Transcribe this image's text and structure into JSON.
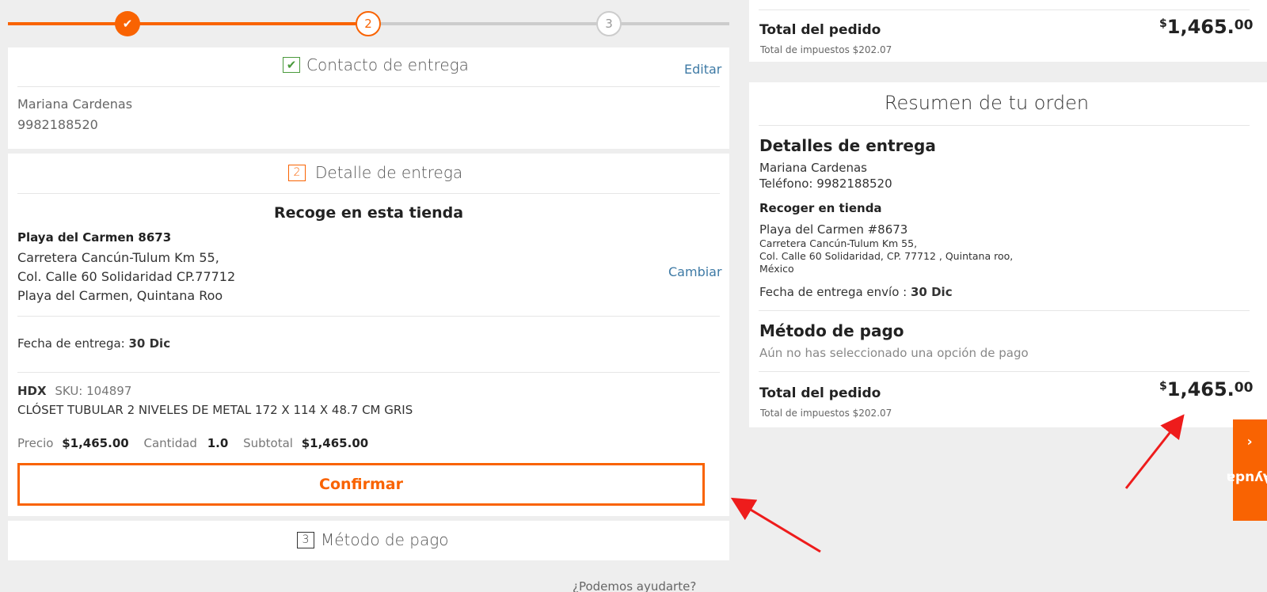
{
  "stepper": {
    "steps": [
      {
        "label": "✔",
        "state": "done"
      },
      {
        "label": "2",
        "state": "active"
      },
      {
        "label": "3",
        "state": "pending"
      }
    ]
  },
  "contact": {
    "title": "Contacto de entrega",
    "edit_label": "Editar",
    "name": "Mariana Cardenas",
    "phone": "9982188520"
  },
  "delivery": {
    "step_number": "2",
    "title": "Detalle de entrega",
    "pickup_heading": "Recoge en esta tienda",
    "store_name": "Playa del Carmen 8673",
    "address_line1": "Carretera Cancún-Tulum Km 55,",
    "address_line2": "Col. Calle 60 Solidaridad CP.77712",
    "address_line3": "Playa del Carmen, Quintana Roo",
    "change_label": "Cambiar",
    "date_label": "Fecha de entrega:",
    "date_value": "30 Dic",
    "product": {
      "brand": "HDX",
      "sku": "SKU: 104897",
      "name": "CLÓSET TUBULAR 2 NIVELES DE METAL 172 X 114 X 48.7 CM GRIS",
      "price_label": "Precio",
      "price_value": "$1,465.00",
      "qty_label": "Cantidad",
      "qty_value": "1.0",
      "subtotal_label": "Subtotal",
      "subtotal_value": "$1,465.00"
    },
    "confirm_label": "Confirmar"
  },
  "payment_step": {
    "step_number": "3",
    "title": "Método de pago"
  },
  "footer": {
    "help_text": "¿Podemos ayudarte?"
  },
  "top_total": {
    "label": "Total del pedido",
    "tax": "Total de impuestos $202.07",
    "currency": "$",
    "amount": "1,465.",
    "cents": "00"
  },
  "summary": {
    "title": "Resumen de tu orden",
    "delivery_heading": "Detalles de entrega",
    "name": "Mariana Cardenas",
    "phone": "Teléfono: 9982188520",
    "pickup_heading": "Recoger en tienda",
    "store": "Playa del Carmen #8673",
    "addr1": "Carretera Cancún-Tulum Km 55,",
    "addr2": "Col. Calle 60 Solidaridad, CP. 77712 , Quintana roo,",
    "addr3": "México",
    "date_label": "Fecha de entrega envío :",
    "date_value": "30 Dic",
    "payment_heading": "Método de pago",
    "payment_note": "Aún no has seleccionado una opción de pago",
    "total_label": "Total del pedido",
    "tax": "Total de impuestos $202.07",
    "currency": "$",
    "amount": "1,465.",
    "cents": "00"
  },
  "help_tab": {
    "label": "Ayuda",
    "icon": "chevron-up-icon"
  },
  "colors": {
    "accent": "#f96302",
    "link": "#3e7aa5",
    "check": "#4a9a3c",
    "annotation_arrow": "#ee1c1c"
  }
}
